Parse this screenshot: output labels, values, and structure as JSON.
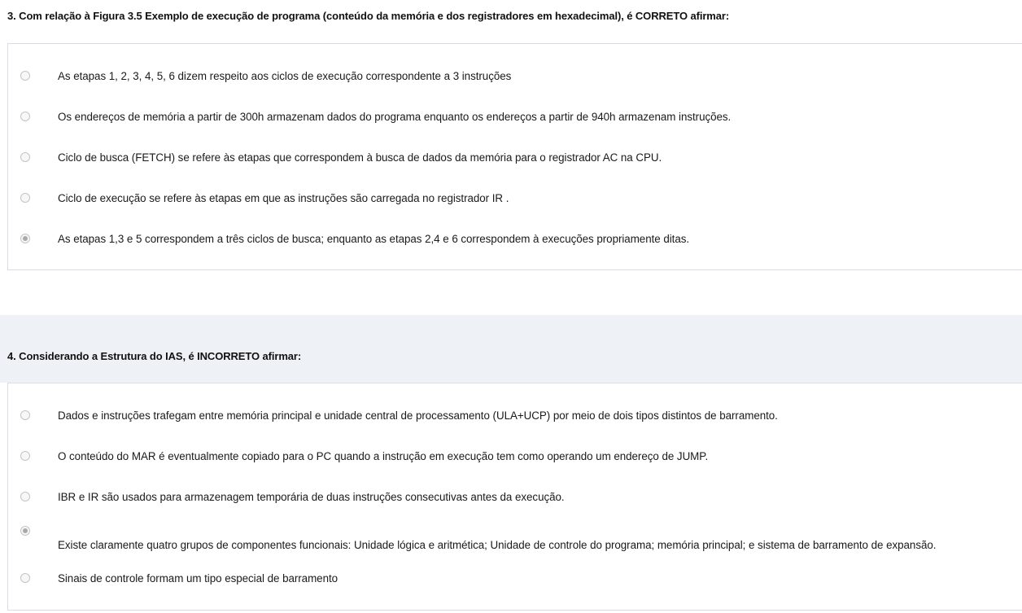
{
  "questions": [
    {
      "title": "3. Com relação à Figura 3.5 Exemplo de execução de programa (conteúdo da memória e dos registradores em hexadecimal), é CORRETO afirmar:",
      "options": [
        {
          "label": "As etapas 1, 2, 3, 4, 5, 6 dizem respeito aos ciclos de execução correspondente a 3 instruções",
          "selected": false
        },
        {
          "label": "Os endereços de memória a partir de 300h armazenam dados do programa enquanto os endereços a partir de 940h armazenam instruções.",
          "selected": false
        },
        {
          "label": "Ciclo de busca (FETCH) se refere às etapas que correspondem à busca de dados da memória para o registrador AC na CPU.",
          "selected": false
        },
        {
          "label": "Ciclo de execução se refere às etapas em que as instruções são carregada no registrador IR .",
          "selected": false
        },
        {
          "label": "As etapas 1,3 e 5 correspondem a três ciclos de busca; enquanto as etapas 2,4 e 6 correspondem à execuções propriamente ditas.",
          "selected": true
        }
      ]
    },
    {
      "title": "4. Considerando a Estrutura do IAS, é INCORRETO afirmar:",
      "options": [
        {
          "label": "Dados e instruções trafegam entre memória principal e unidade central de processamento (ULA+UCP) por meio de dois tipos distintos de barramento.",
          "selected": false
        },
        {
          "label": "O conteúdo do MAR é eventualmente copiado para o PC quando a instrução em execução tem como operando um endereço de JUMP.",
          "selected": false
        },
        {
          "label": "IBR e IR são usados para armazenagem temporária de duas instruções consecutivas antes da execução.",
          "selected": false
        },
        {
          "label": "Existe claramente quatro grupos de componentes funcionais: Unidade lógica e aritmética; Unidade de controle do programa; memória principal; e sistema de barramento de expansão.",
          "selected": true
        },
        {
          "label": "Sinais de controle formam um tipo especial de barramento",
          "selected": false
        }
      ]
    }
  ]
}
